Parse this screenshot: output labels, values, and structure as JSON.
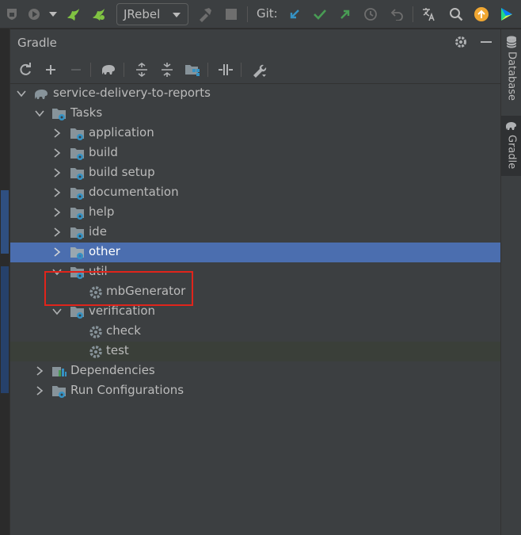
{
  "toolbar": {
    "jrebel_label": "JRebel",
    "git_label": "Git:"
  },
  "panel": {
    "title": "Gradle"
  },
  "tree": {
    "root": "service-delivery-to-reports",
    "tasks": "Tasks",
    "groups": {
      "application": "application",
      "build": "build",
      "build_setup": "build setup",
      "documentation": "documentation",
      "help": "help",
      "ide": "ide",
      "other": "other",
      "util": "util",
      "verification": "verification"
    },
    "util_tasks": {
      "mbgenerator": "mbGenerator"
    },
    "verification_tasks": {
      "check": "check",
      "test": "test"
    },
    "dependencies": "Dependencies",
    "run_configurations": "Run Configurations"
  },
  "right_stripe": {
    "database": "Database",
    "gradle": "Gradle"
  },
  "colors": {
    "selection": "#4b6eaf",
    "highlight_border": "#e0241b",
    "git_update": "#3592c4",
    "git_commit": "#499c54",
    "git_push": "#499c54",
    "folder": "#87939a",
    "gear_badge": "#3592c4",
    "orange_badge": "#f0a732"
  },
  "icons": [
    "shield-icon",
    "run-coverage-icon",
    "dropdown-icon",
    "jrebel-run-icon",
    "jrebel-debug-icon",
    "hammer-icon",
    "stop-icon",
    "git-update-icon",
    "git-commit-icon",
    "git-push-icon",
    "history-icon",
    "rollback-icon",
    "translate-icon",
    "search-icon",
    "update-icon",
    "plugin-icon",
    "refresh-icon",
    "add-icon",
    "remove-icon",
    "elephant-icon",
    "expand-all-icon",
    "collapse-all-icon",
    "group-modules-icon",
    "toggle-offline-icon",
    "wrench-icon",
    "gear-icon",
    "minimize-icon",
    "chevron-right-icon",
    "chevron-down-icon",
    "folder-gear-icon",
    "task-gear-icon",
    "dependencies-icon",
    "database-icon"
  ]
}
